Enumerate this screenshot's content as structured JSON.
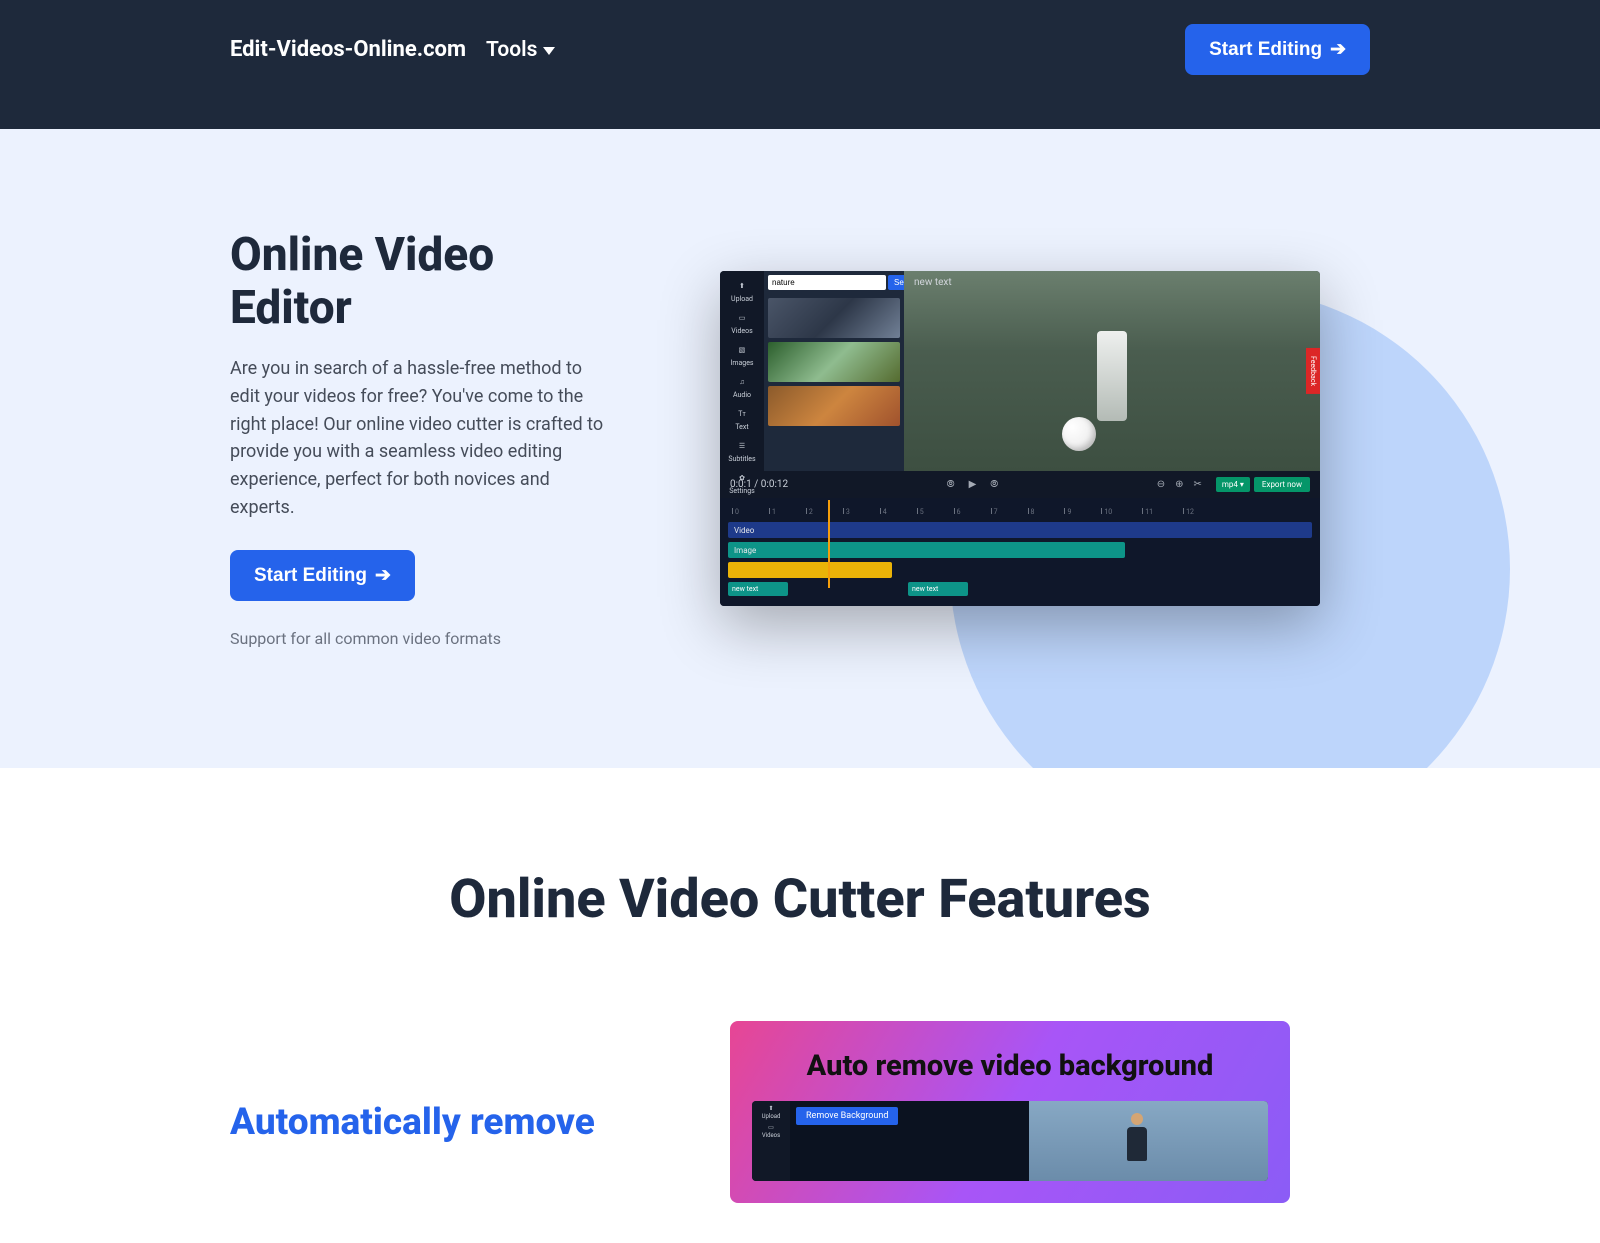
{
  "header": {
    "logo": "Edit-Videos-Online.com",
    "tools_label": "Tools",
    "cta_label": "Start Editing",
    "cta_arrow": "➔"
  },
  "hero": {
    "title": "Online Video Editor",
    "description": "Are you in search of a hassle-free method to edit your videos for free? You've come to the right place! Our online video cutter is crafted to provide you with a seamless video editing experience, perfect for both novices and experts.",
    "cta_label": "Start Editing",
    "cta_arrow": "➔",
    "note": "Support for all common video formats"
  },
  "editor": {
    "sidebar": [
      {
        "label": "Upload",
        "icon": "⬆"
      },
      {
        "label": "Videos",
        "icon": "▭"
      },
      {
        "label": "Images",
        "icon": "▧"
      },
      {
        "label": "Audio",
        "icon": "♫"
      },
      {
        "label": "Text",
        "icon": "Tᴛ"
      },
      {
        "label": "Subtitles",
        "icon": "☰"
      },
      {
        "label": "Settings",
        "icon": "✿"
      }
    ],
    "search_value": "nature",
    "search_button": "Search",
    "preview_text": "new text",
    "feedback": "Feedback",
    "time": "0:0:1 / 0:0:12",
    "export_format": "mp4 ▾",
    "export_label": "Export now",
    "tracks": {
      "video": "Video",
      "image": "Image",
      "audio": "",
      "text1": "new text",
      "text2": "new text"
    }
  },
  "features": {
    "title": "Online Video Cutter Features",
    "item1_heading": "Automatically remove",
    "card_title": "Auto remove video background",
    "mini_tab": "Remove Background",
    "mini_sidebar": [
      {
        "label": "Upload",
        "icon": "⬆"
      },
      {
        "label": "Videos",
        "icon": "▭"
      }
    ]
  }
}
